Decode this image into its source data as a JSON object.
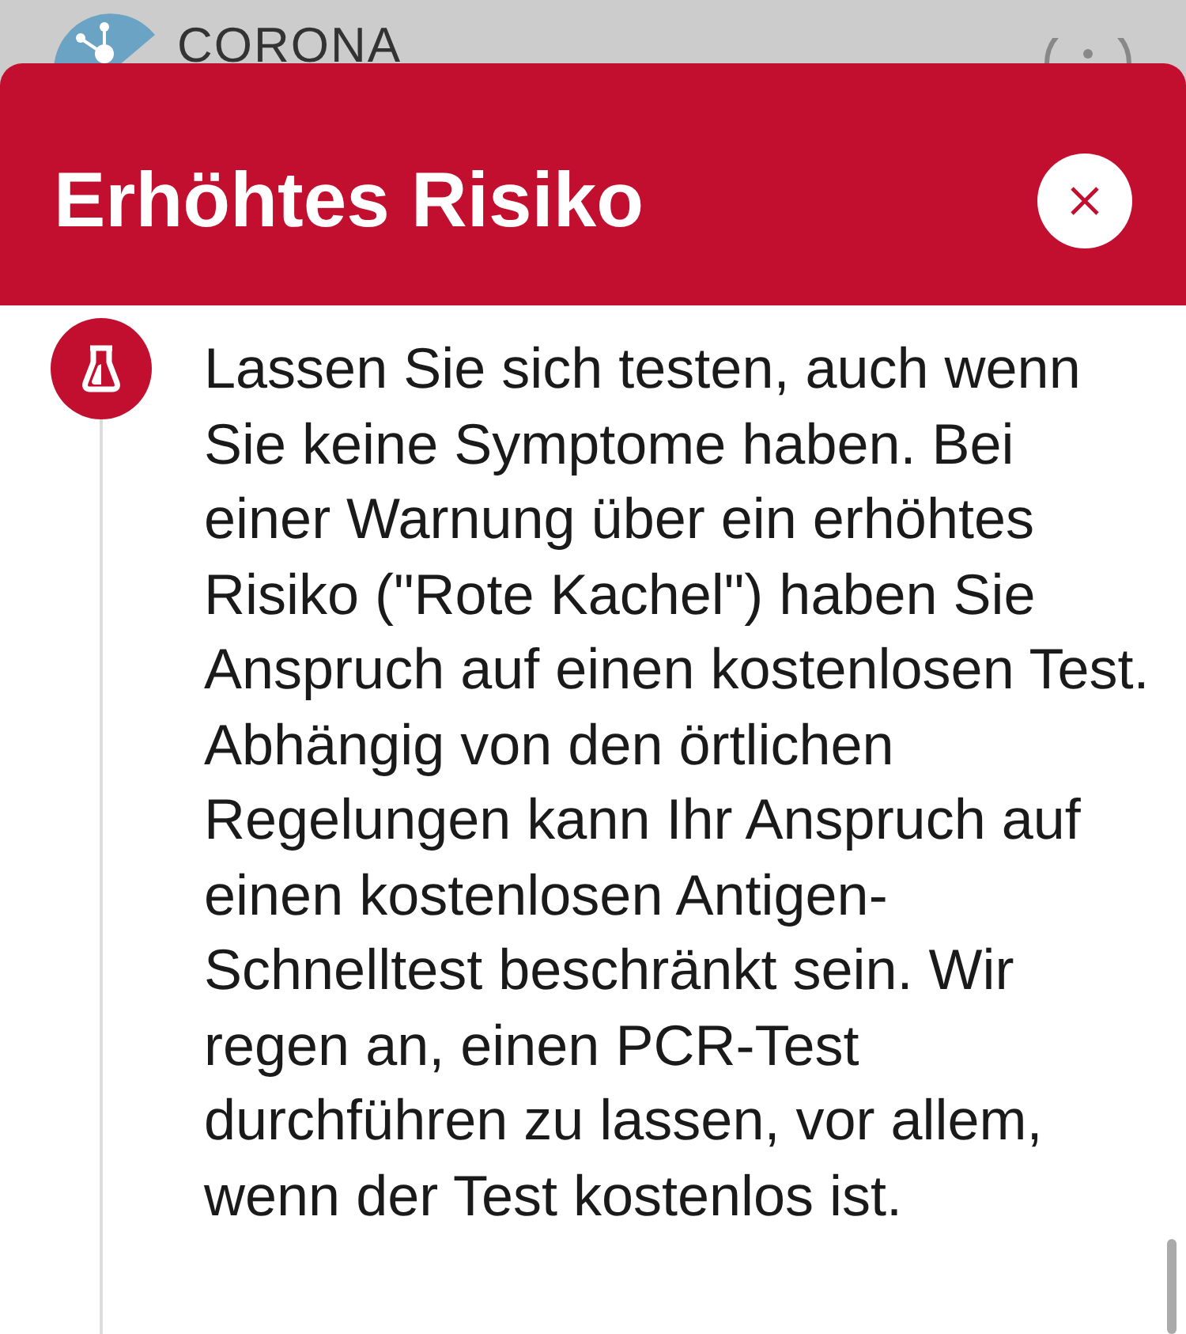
{
  "app_header": {
    "logo_text": "CORONA"
  },
  "sheet": {
    "title": "Erhöhtes Risiko"
  },
  "steps": [
    {
      "kind": "test",
      "text": "Lassen Sie sich testen, auch wenn Sie keine Symptome haben. Bei einer Warnung über ein erhöhtes Risiko (\"Rote Kachel\") haben Sie Anspruch auf einen kostenlosen Test. Abhängig von den örtlichen Regelungen kann Ihr Anspruch auf einen kostenlosen Antigen-Schnelltest beschränkt sein. Wir regen an, einen PCR-Test durchführen zu lassen, vor allem, wenn der Test kostenlos ist."
    }
  ]
}
